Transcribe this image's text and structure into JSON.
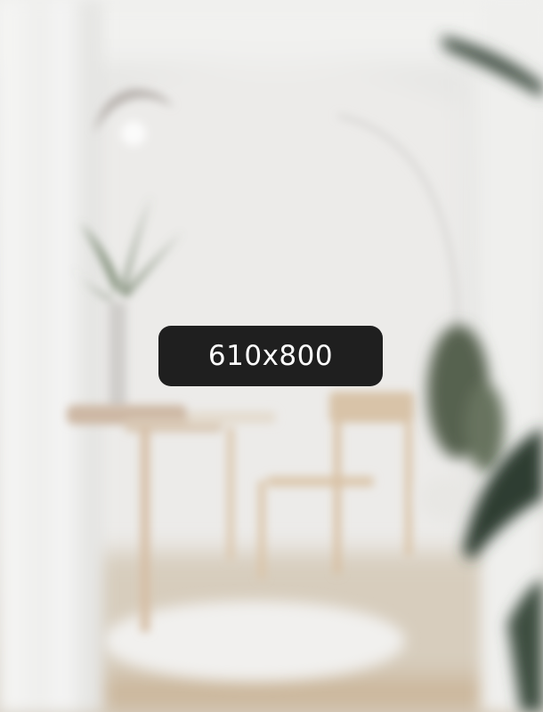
{
  "placeholder": {
    "dimensions_label": "610x800",
    "colors": {
      "badge_background": "#1f1f1f",
      "badge_text": "#ffffff",
      "wall": "#ececea",
      "floor_wood": "#cdbca4",
      "plant_green": "#3b4d3e"
    }
  }
}
